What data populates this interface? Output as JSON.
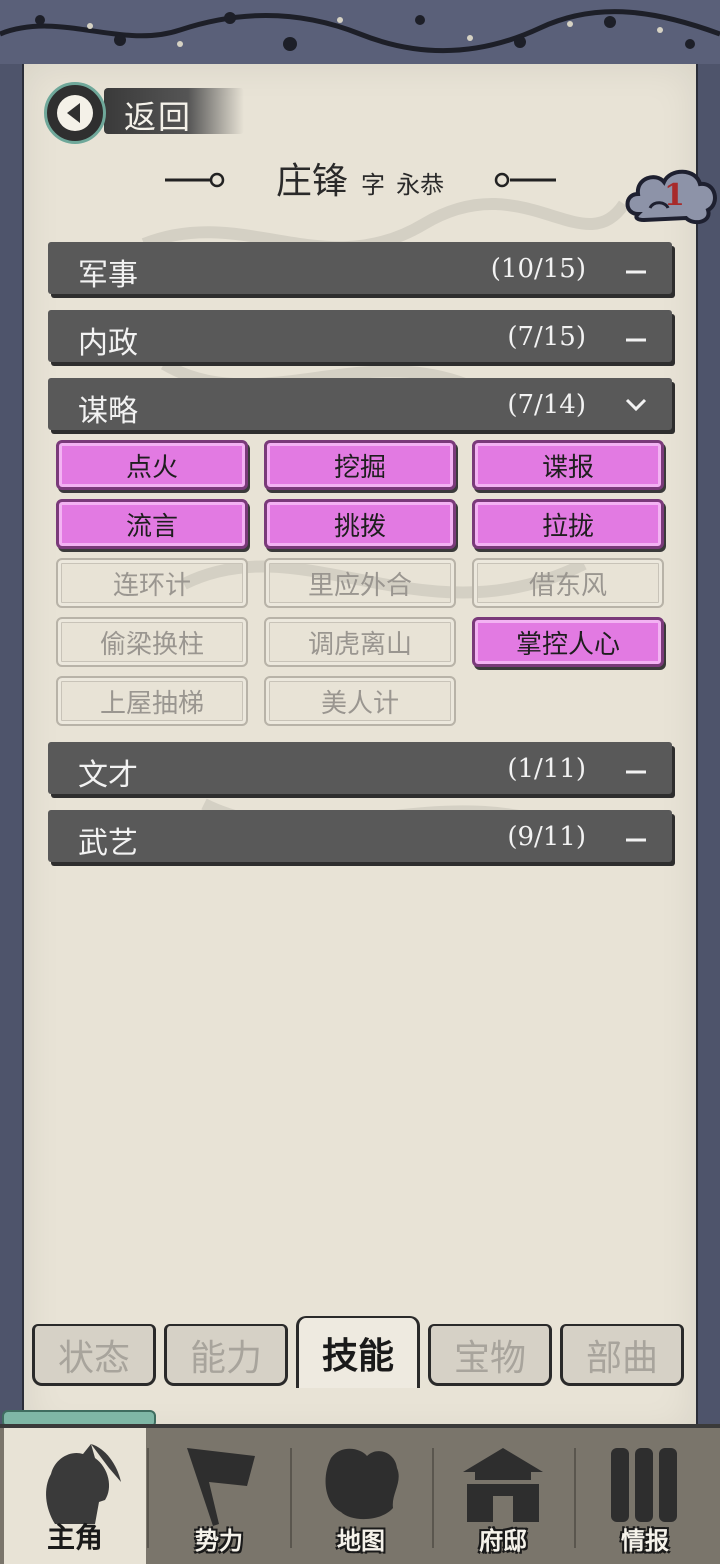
{
  "header": {
    "back_label": "返回",
    "character_name": "庄锋",
    "zi_label": "字",
    "courtesy_name": "永恭",
    "badge_count": "1"
  },
  "categories": [
    {
      "name": "军事",
      "count": "(10/15)",
      "state": "collapsed"
    },
    {
      "name": "内政",
      "count": "(7/15)",
      "state": "collapsed"
    },
    {
      "name": "谋略",
      "count": "(7/14)",
      "state": "expanded"
    },
    {
      "name": "文才",
      "count": "(1/11)",
      "state": "collapsed"
    },
    {
      "name": "武艺",
      "count": "(9/11)",
      "state": "collapsed"
    }
  ],
  "strategy_skills": [
    {
      "label": "点火",
      "learned": true
    },
    {
      "label": "挖掘",
      "learned": true
    },
    {
      "label": "谍报",
      "learned": true
    },
    {
      "label": "流言",
      "learned": true
    },
    {
      "label": "挑拨",
      "learned": true
    },
    {
      "label": "拉拢",
      "learned": true
    },
    {
      "label": "连环计",
      "learned": false
    },
    {
      "label": "里应外合",
      "learned": false
    },
    {
      "label": "借东风",
      "learned": false
    },
    {
      "label": "偷梁换柱",
      "learned": false
    },
    {
      "label": "调虎离山",
      "learned": false
    },
    {
      "label": "掌控人心",
      "learned": true
    },
    {
      "label": "上屋抽梯",
      "learned": false
    },
    {
      "label": "美人计",
      "learned": false
    }
  ],
  "section_tabs": [
    {
      "label": "状态",
      "active": false
    },
    {
      "label": "能力",
      "active": false
    },
    {
      "label": "技能",
      "active": true
    },
    {
      "label": "宝物",
      "active": false
    },
    {
      "label": "部曲",
      "active": false
    }
  ],
  "bottom_nav": [
    {
      "label": "主角",
      "icon": "hero-portrait-icon",
      "active": true
    },
    {
      "label": "势力",
      "icon": "banner-flag-icon",
      "active": false
    },
    {
      "label": "地图",
      "icon": "map-icon",
      "active": false
    },
    {
      "label": "府邸",
      "icon": "mansion-icon",
      "active": false
    },
    {
      "label": "情报",
      "icon": "scrolls-icon",
      "active": false
    }
  ],
  "colors": {
    "learned_skill": "#e27ae2",
    "category_bar": "#595959",
    "parchment": "#e8e3d6",
    "badge_text": "#a82a2a"
  }
}
